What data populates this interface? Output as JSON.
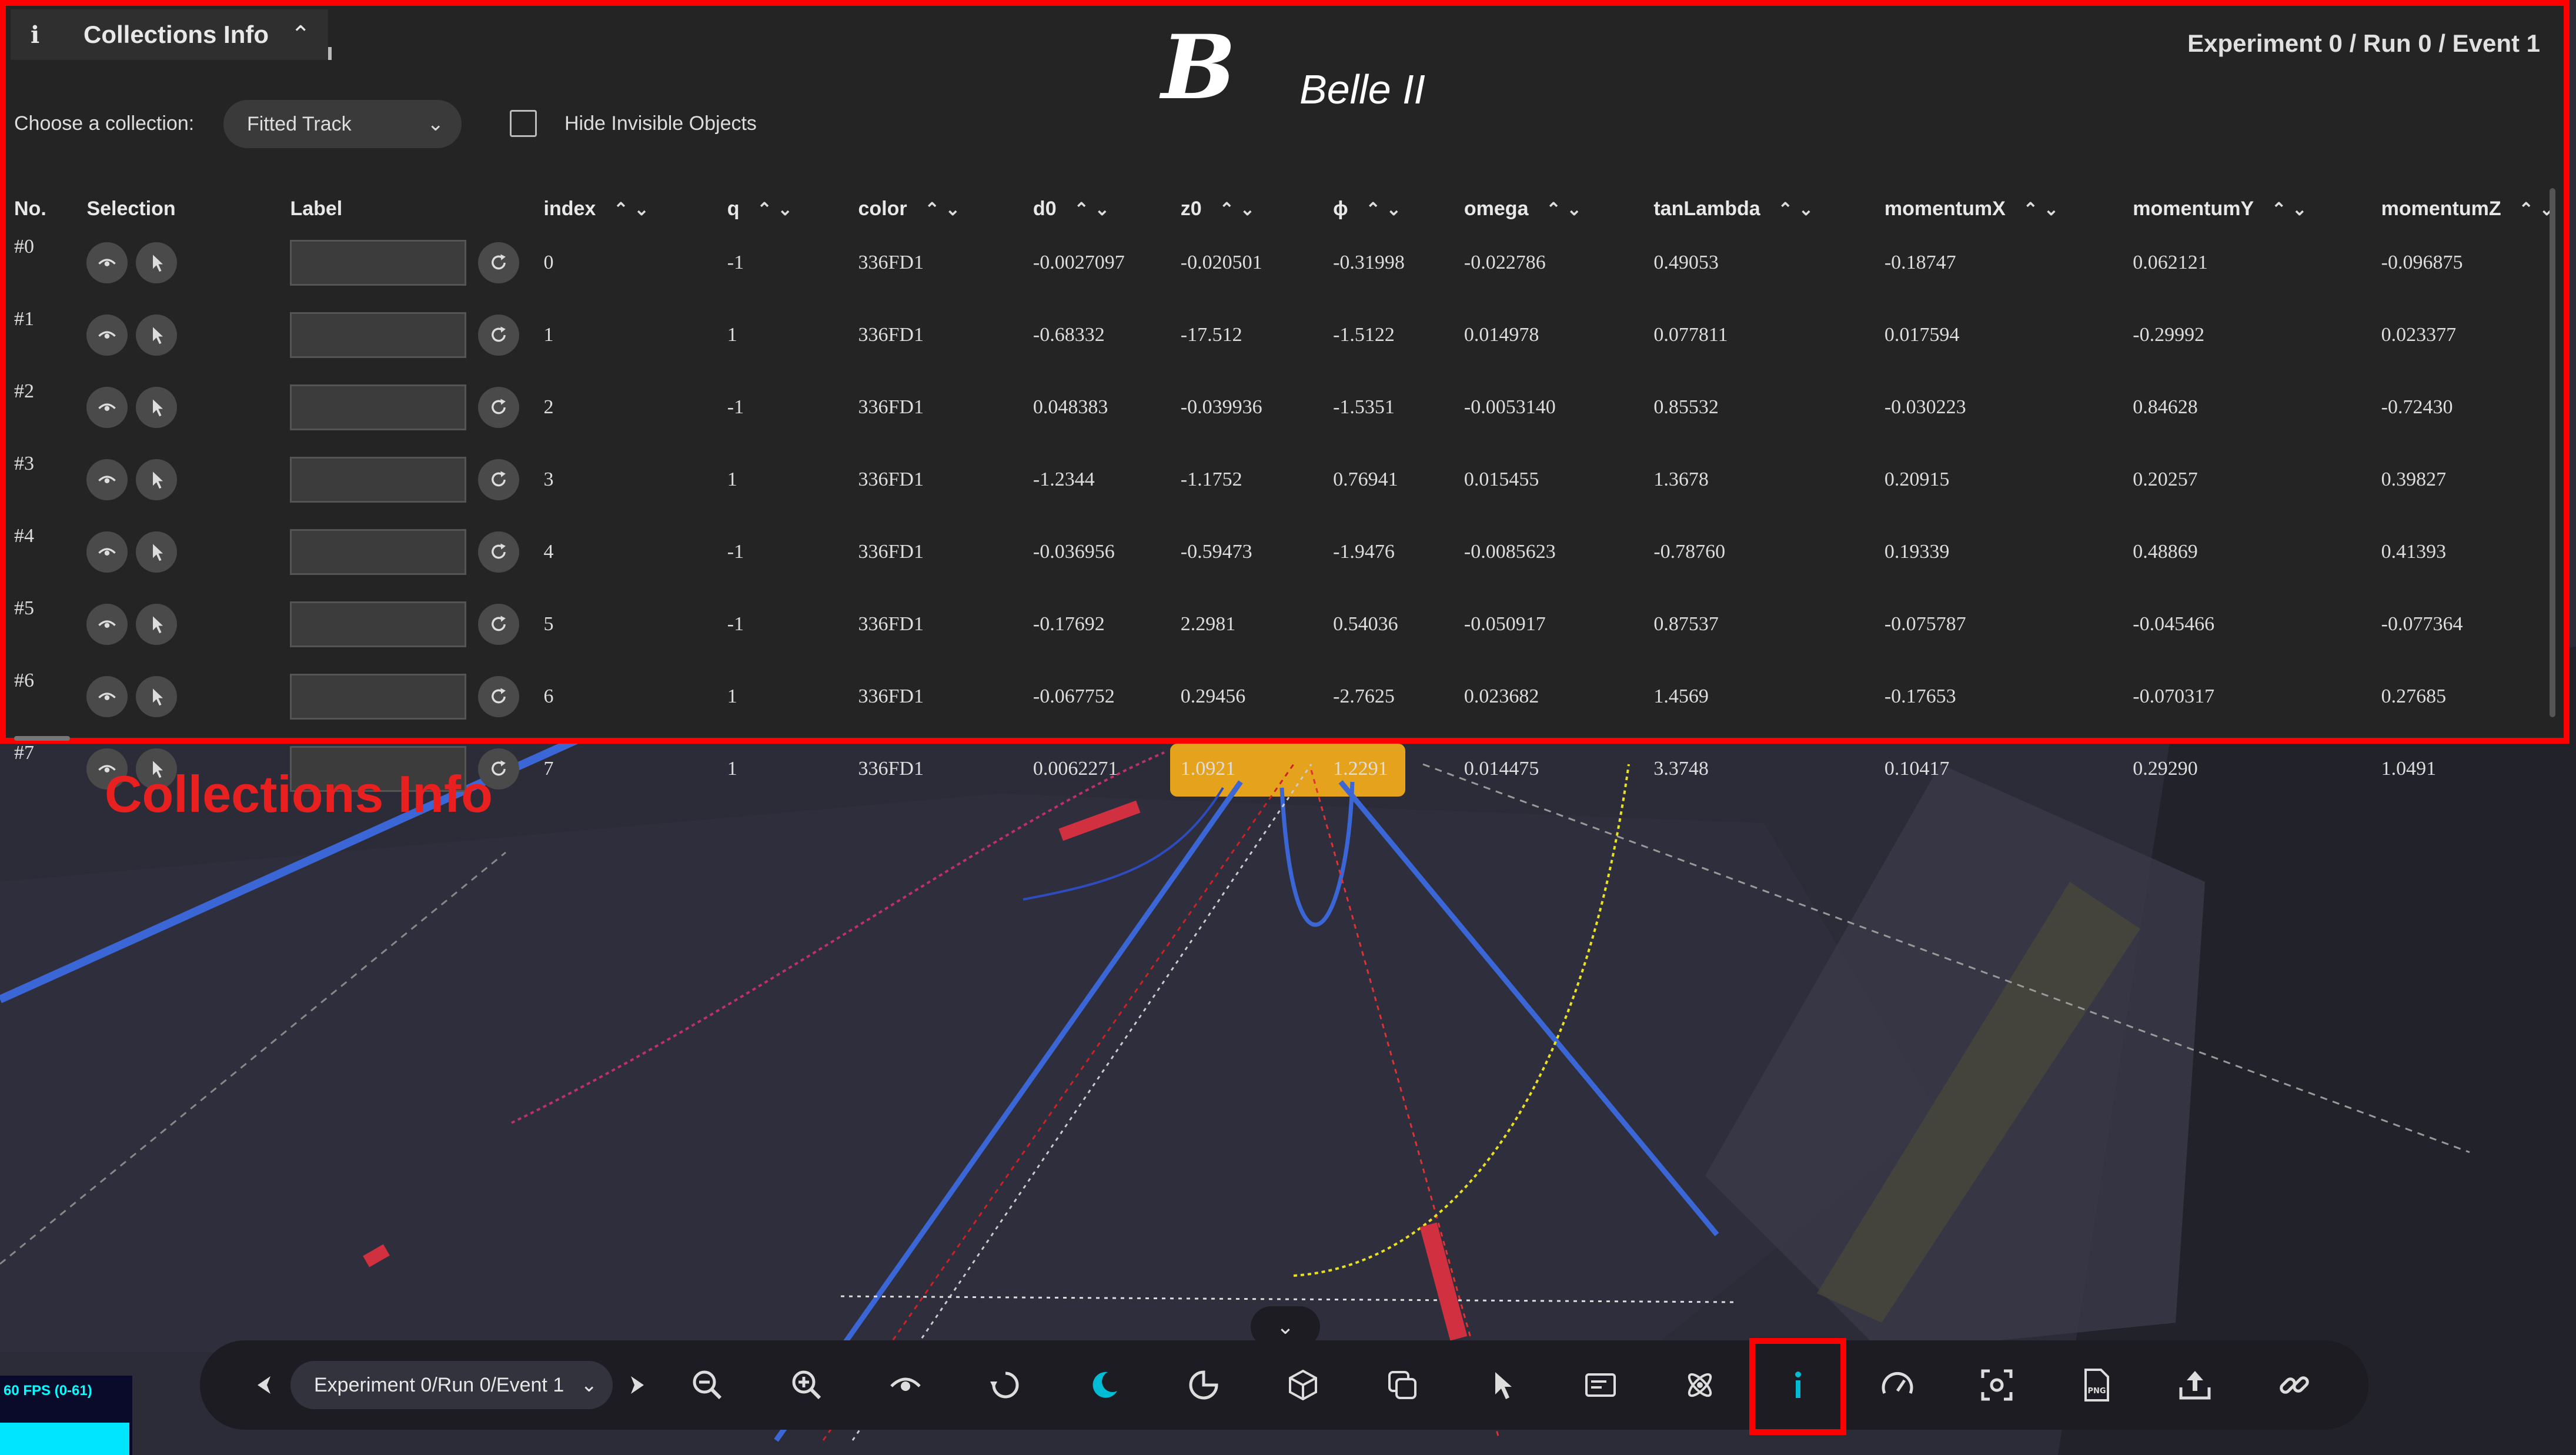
{
  "panel": {
    "title": "Collections Info",
    "experiment_label": "Experiment 0 / Run 0 / Event 1",
    "logo_text": "Belle II",
    "choose_label": "Choose a collection:",
    "collection_value": "Fitted Track",
    "hide_invisible_label": "Hide Invisible Objects",
    "columns": [
      "No.",
      "Selection",
      "Label",
      "index",
      "q",
      "color",
      "d0",
      "z0",
      "ϕ",
      "omega",
      "tanLambda",
      "momentumX",
      "momentumY",
      "momentumZ"
    ],
    "rows": [
      {
        "no": "#0",
        "index": "0",
        "q": "-1",
        "color": "336FD1",
        "d0": "-0.0027097",
        "z0": "-0.020501",
        "phi": "-0.31998",
        "omega": "-0.022786",
        "tanLambda": "0.49053",
        "mx": "-0.18747",
        "my": "0.062121",
        "mz": "-0.096875"
      },
      {
        "no": "#1",
        "index": "1",
        "q": "1",
        "color": "336FD1",
        "d0": "-0.68332",
        "z0": "-17.512",
        "phi": "-1.5122",
        "omega": "0.014978",
        "tanLambda": "0.077811",
        "mx": "0.017594",
        "my": "-0.29992",
        "mz": "0.023377"
      },
      {
        "no": "#2",
        "index": "2",
        "q": "-1",
        "color": "336FD1",
        "d0": "0.048383",
        "z0": "-0.039936",
        "phi": "-1.5351",
        "omega": "-0.0053140",
        "tanLambda": "0.85532",
        "mx": "-0.030223",
        "my": "0.84628",
        "mz": "-0.72430"
      },
      {
        "no": "#3",
        "index": "3",
        "q": "1",
        "color": "336FD1",
        "d0": "-1.2344",
        "z0": "-1.1752",
        "phi": "0.76941",
        "omega": "0.015455",
        "tanLambda": "1.3678",
        "mx": "0.20915",
        "my": "0.20257",
        "mz": "0.39827"
      },
      {
        "no": "#4",
        "index": "4",
        "q": "-1",
        "color": "336FD1",
        "d0": "-0.036956",
        "z0": "-0.59473",
        "phi": "-1.9476",
        "omega": "-0.0085623",
        "tanLambda": "-0.78760",
        "mx": "0.19339",
        "my": "0.48869",
        "mz": "0.41393"
      },
      {
        "no": "#5",
        "index": "5",
        "q": "-1",
        "color": "336FD1",
        "d0": "-0.17692",
        "z0": "2.2981",
        "phi": "0.54036",
        "omega": "-0.050917",
        "tanLambda": "0.87537",
        "mx": "-0.075787",
        "my": "-0.045466",
        "mz": "-0.077364"
      },
      {
        "no": "#6",
        "index": "6",
        "q": "1",
        "color": "336FD1",
        "d0": "-0.067752",
        "z0": "0.29456",
        "phi": "-2.7625",
        "omega": "0.023682",
        "tanLambda": "1.4569",
        "mx": "-0.17653",
        "my": "-0.070317",
        "mz": "0.27685"
      },
      {
        "no": "#7",
        "index": "7",
        "q": "1",
        "color": "336FD1",
        "d0": "0.0062271",
        "z0": "1.0921",
        "phi": "1.2291",
        "omega": "0.014475",
        "tanLambda": "3.3748",
        "mx": "0.10417",
        "my": "0.29290",
        "mz": "1.0491"
      }
    ]
  },
  "annotation": "Collections Info",
  "toolbar": {
    "event_value": "Experiment 0/Run 0/Event 1",
    "icons": [
      "prev-arrow-icon",
      "zoom-out-icon",
      "zoom-in-icon",
      "eye-icon",
      "rotate-icon",
      "dark-mode-icon",
      "clipping-icon",
      "cube-icon",
      "layers-icon",
      "pointer-icon",
      "overlay-icon",
      "atom-icon",
      "info-icon",
      "speed-icon",
      "screenshot-icon",
      "png-icon",
      "export-icon",
      "link-icon"
    ]
  },
  "fps": "60 FPS (0-61)",
  "colors": {
    "accent": "#00bcd4",
    "highlight": "#ff0000",
    "panel_bg": "#242424",
    "track_blue": "#3a66d6"
  }
}
